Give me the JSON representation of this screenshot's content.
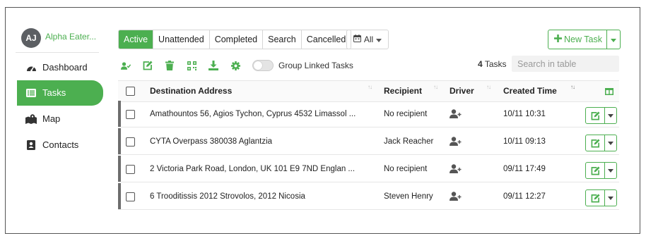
{
  "profile": {
    "initials": "AJ",
    "name": "Alpha Eater..."
  },
  "sidebar": {
    "items": [
      {
        "label": "Dashboard",
        "icon": "dashboard-gauge-icon",
        "active": false
      },
      {
        "label": "Tasks",
        "icon": "list-icon",
        "active": true
      },
      {
        "label": "Map",
        "icon": "map-icon",
        "active": false
      },
      {
        "label": "Contacts",
        "icon": "contacts-icon",
        "active": false
      }
    ]
  },
  "tabs": [
    {
      "label": "Active",
      "active": true
    },
    {
      "label": "Unattended",
      "active": false
    },
    {
      "label": "Completed",
      "active": false
    },
    {
      "label": "Search",
      "active": false
    },
    {
      "label": "Cancelled",
      "active": false
    }
  ],
  "filter": {
    "label": "All",
    "icon": "calendar-icon"
  },
  "new_task": {
    "label": "New Task",
    "icon": "plus-icon"
  },
  "toolbar": {
    "icons": [
      "assign-user-icon",
      "edit-icon",
      "trash-icon",
      "qr-code-icon",
      "download-icon",
      "gear-icon"
    ],
    "group_linked_label": "Group Linked Tasks",
    "group_linked_on": false
  },
  "task_count": {
    "number": "4",
    "label": "Tasks"
  },
  "search": {
    "placeholder": "Search in table",
    "value": ""
  },
  "table": {
    "columns": [
      "Destination Address",
      "Recipient",
      "Driver",
      "Created Time"
    ],
    "rows": [
      {
        "address": "Amathountos 56, Agios Tychon, Cyprus 4532 Limassol ...",
        "recipient": "No recipient",
        "created": "10/11 10:31"
      },
      {
        "address": "CYTA Overpass 380038 Aglantzia",
        "recipient": "Jack Reacher",
        "created": "10/11 09:13"
      },
      {
        "address": "2 Victoria Park Road, London, UK 101 E9 7ND Englan ...",
        "recipient": "No recipient",
        "created": "09/11 17:49"
      },
      {
        "address": "6 Trooditissis 2012 Strovolos, 2012 Nicosia",
        "recipient": "Steven Henry",
        "created": "09/11 12:27"
      }
    ]
  },
  "colors": {
    "accent": "#4caf50",
    "row_marker": "#6d6d6d",
    "text": "#222222"
  }
}
